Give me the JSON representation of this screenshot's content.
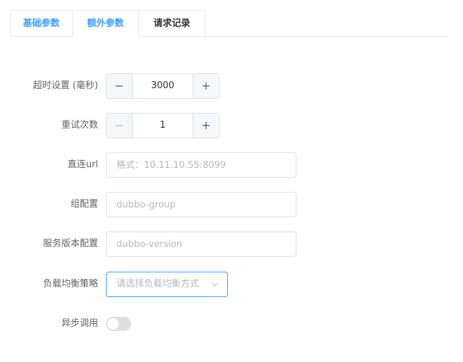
{
  "tabs": [
    {
      "label": "基础参数"
    },
    {
      "label": "额外参数"
    },
    {
      "label": "请求记录"
    }
  ],
  "form": {
    "timeout": {
      "label": "超时设置 (毫秒)",
      "value": "3000",
      "minus": "−",
      "plus": "+"
    },
    "retries": {
      "label": "重试次数",
      "value": "1",
      "minus": "−",
      "plus": "+"
    },
    "direct_url": {
      "label": "直连url",
      "value": "",
      "placeholder": "格式：10.11.10.55:8099"
    },
    "group": {
      "label": "组配置",
      "value": "",
      "placeholder": "dubbo-group"
    },
    "version": {
      "label": "服务版本配置",
      "value": "",
      "placeholder": "dubbo-version"
    },
    "load_balance": {
      "label": "负载均衡策略",
      "placeholder": "请选择负载均衡方式"
    },
    "async": {
      "label": "异步调用",
      "enabled": false
    }
  },
  "colors": {
    "accent": "#409eff",
    "border": "#dcdfe6",
    "label": "#606266",
    "placeholder": "#b4b7bd"
  }
}
